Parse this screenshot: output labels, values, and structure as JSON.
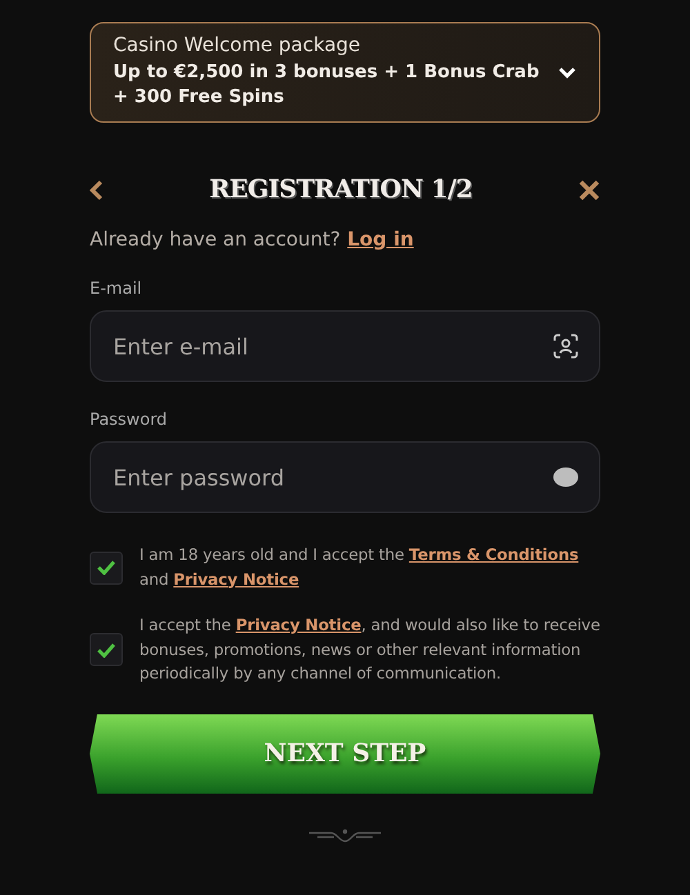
{
  "promo": {
    "title": "Casino Welcome package",
    "offer": "Up to €2,500 in 3 bonuses + 1 Bonus Crab + 300 Free Spins",
    "expanded": false
  },
  "header": {
    "title": "REGISTRATION 1/2"
  },
  "login_prompt": {
    "text": "Already have an account?",
    "link": "Log in"
  },
  "fields": [
    {
      "label": "E-mail",
      "placeholder": "Enter e-mail",
      "kind": "email"
    },
    {
      "label": "Password",
      "placeholder": "Enter password",
      "kind": "password"
    }
  ],
  "consents": [
    {
      "checked": true,
      "parts": [
        {
          "kind": "text",
          "text": "I am 18 years old and I accept the "
        },
        {
          "kind": "link",
          "text": "Terms & Conditions"
        },
        {
          "kind": "text",
          "text": " and "
        },
        {
          "kind": "link",
          "text": "Privacy Notice"
        }
      ]
    },
    {
      "checked": true,
      "parts": [
        {
          "kind": "text",
          "text": "I accept the "
        },
        {
          "kind": "link",
          "text": "Privacy Notice"
        },
        {
          "kind": "text",
          "text": ", and would also like to receive bonuses, promotions, news or other relevant information periodically by any channel of communication."
        }
      ]
    }
  ],
  "submit": "NEXT STEP"
}
